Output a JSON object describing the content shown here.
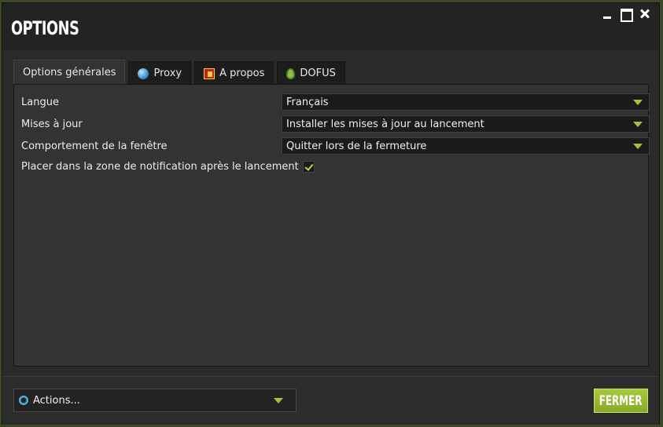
{
  "window": {
    "title": "OPTIONS"
  },
  "tabs": [
    {
      "label": "Options générales",
      "icon": "none",
      "active": true
    },
    {
      "label": "Proxy",
      "icon": "globe-icon"
    },
    {
      "label": "A propos",
      "icon": "info-icon"
    },
    {
      "label": "DOFUS",
      "icon": "egg-icon"
    }
  ],
  "settings": {
    "language": {
      "label": "Langue",
      "value": "Français"
    },
    "updates": {
      "label": "Mises à jour",
      "value": "Installer les mises à jour au lancement"
    },
    "window_behavior": {
      "label": "Comportement de la fenêtre",
      "value": "Quitter lors de la fermeture"
    },
    "tray": {
      "label": "Placer dans la zone de notification après le lancement",
      "checked": true
    }
  },
  "footer": {
    "actions_label": "Actions...",
    "close_label": "FERMER"
  },
  "colors": {
    "accent": "#a6c43a",
    "background": "#2a2a2a",
    "panel": "#333333"
  }
}
